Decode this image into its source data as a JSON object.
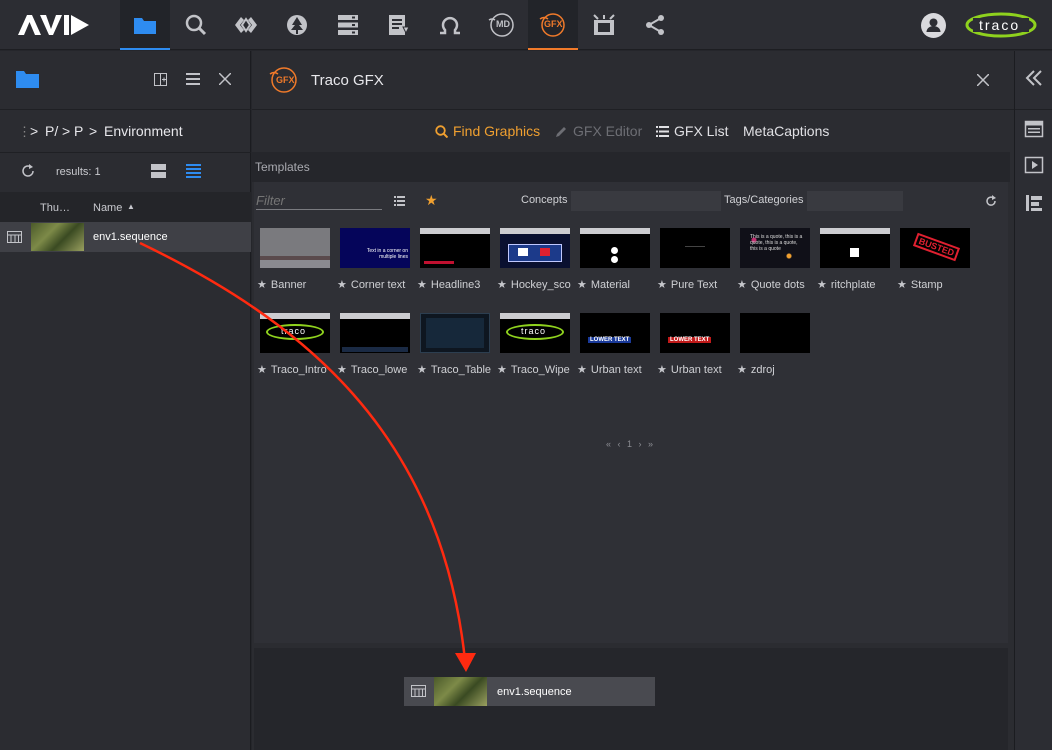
{
  "topbar": {
    "logo": "AVID",
    "nav": [
      "folder-icon",
      "search-icon",
      "link-icon",
      "tree-icon",
      "server-icon",
      "document-icon",
      "omega-icon",
      "md-icon",
      "gfx-icon",
      "storyboard-icon",
      "share-icon"
    ],
    "md_label": "MD",
    "gfx_label": "GFX",
    "brand": "traco"
  },
  "left": {
    "breadcrumb": [
      "P/",
      "P",
      "Environment"
    ],
    "results": "results: 1",
    "columns": {
      "thumb": "Thu…",
      "name": "Name"
    },
    "rows": [
      {
        "name": "env1.sequence"
      }
    ]
  },
  "main": {
    "title": "Traco GFX",
    "logo_label": "GFX",
    "tabs": {
      "find": "Find Graphics",
      "editor": "GFX Editor",
      "list": "GFX List",
      "captions": "MetaCaptions"
    },
    "section": "Templates",
    "filter_placeholder": "Filter",
    "concepts_label": "Concepts",
    "tags_label": "Tags/Categories",
    "pagination": "« ‹ 1 › »",
    "templates": [
      {
        "label": "Banner"
      },
      {
        "label": "Corner text"
      },
      {
        "label": "Headline3"
      },
      {
        "label": "Hockey_sco"
      },
      {
        "label": "Material"
      },
      {
        "label": "Pure Text"
      },
      {
        "label": "Quote dots"
      },
      {
        "label": "ritchplate"
      },
      {
        "label": "Stamp"
      },
      {
        "label": "Traco_Intro"
      },
      {
        "label": "Traco_lowe"
      },
      {
        "label": "Traco_Table"
      },
      {
        "label": "Traco_Wipe"
      },
      {
        "label": "Urban text"
      },
      {
        "label": "Urban text"
      },
      {
        "label": "zdroj"
      }
    ],
    "thumb_texts": {
      "corner": "Text in a corner on multiple lines",
      "quote": "This is a quote, this is a quote, this is a quote, this is a quote",
      "busted": "BUSTED",
      "traco": "traco",
      "lower": "LOWER TEXT"
    },
    "drop_item": "env1.sequence"
  },
  "colors": {
    "accent_blue": "#2e8cf0",
    "accent_orange": "#f0a030",
    "arrow": "#ff2a10"
  }
}
